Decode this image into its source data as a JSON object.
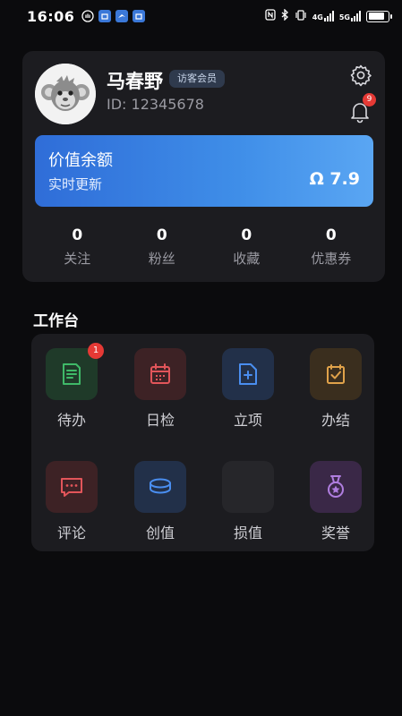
{
  "status_bar": {
    "time": "16:06",
    "network_label": "4G",
    "network_label_2": "5G",
    "battery_level": 0.85
  },
  "profile": {
    "name": "马春野",
    "member_badge": "访客会员",
    "id_text": "ID: 12345678",
    "notification_count": "9"
  },
  "value_card": {
    "title": "价值余额",
    "subtitle": "实时更新",
    "amount": "Ω 7.9"
  },
  "stats": [
    {
      "value": "0",
      "label": "关注"
    },
    {
      "value": "0",
      "label": "粉丝"
    },
    {
      "value": "0",
      "label": "收藏"
    },
    {
      "value": "0",
      "label": "优惠券"
    }
  ],
  "workbench": {
    "title": "工作台",
    "items": [
      {
        "label": "待办",
        "icon": "todo-icon",
        "badge": "1",
        "color": "#3fb968",
        "bg": "#1f3a29"
      },
      {
        "label": "日检",
        "icon": "calendar-icon",
        "color": "#e2555a",
        "bg": "#3d2225"
      },
      {
        "label": "立项",
        "icon": "add-document-icon",
        "color": "#4a8ef0",
        "bg": "#223049"
      },
      {
        "label": "办结",
        "icon": "check-square-icon",
        "color": "#e0a24a",
        "bg": "#3a2e1e"
      },
      {
        "label": "评论",
        "icon": "comment-icon",
        "color": "#e2555a",
        "bg": "#3d2225"
      },
      {
        "label": "创值",
        "icon": "coins-icon",
        "color": "#4a8ef0",
        "bg": "#223049"
      },
      {
        "label": "损值",
        "icon": "blank-icon",
        "color": "#555",
        "bg": "#26262a"
      },
      {
        "label": "奖誉",
        "icon": "medal-icon",
        "color": "#b07ee0",
        "bg": "#3a2847"
      }
    ]
  }
}
